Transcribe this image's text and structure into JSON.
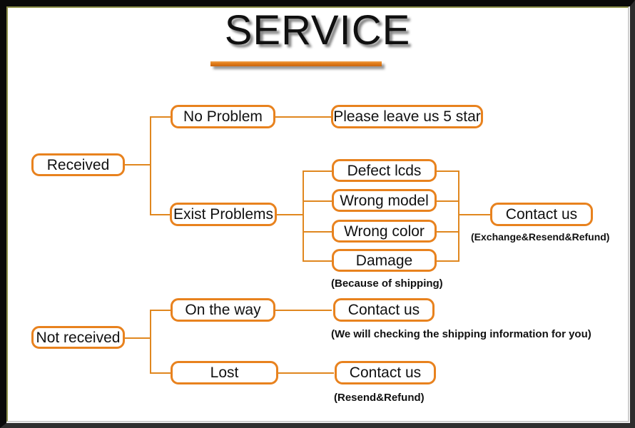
{
  "page": {
    "title": "SERVICE",
    "accent_color": "#e8821e",
    "line_color": "#e0871f",
    "frame_color": "#0a0a0a",
    "background": "#ffffff"
  },
  "nodes": {
    "received": "Received",
    "no_problem": "No Problem",
    "leave_5_star": "Please leave us 5 star",
    "exist_problems": "Exist Problems",
    "defect_lcds": "Defect lcds",
    "wrong_model": "Wrong model",
    "wrong_color": "Wrong color",
    "damage": "Damage",
    "contact_us_problems": "Contact us",
    "not_received": "Not received",
    "on_the_way": "On the way",
    "contact_us_on_the_way": "Contact us",
    "lost": "Lost",
    "contact_us_lost": "Contact us"
  },
  "notes": {
    "because_of_shipping": "(Because of shipping)",
    "exchange_resend_refund": "(Exchange&Resend&Refund)",
    "checking_shipping_info": "(We will checking the shipping information for you)",
    "resend_refund": "(Resend&Refund)"
  }
}
